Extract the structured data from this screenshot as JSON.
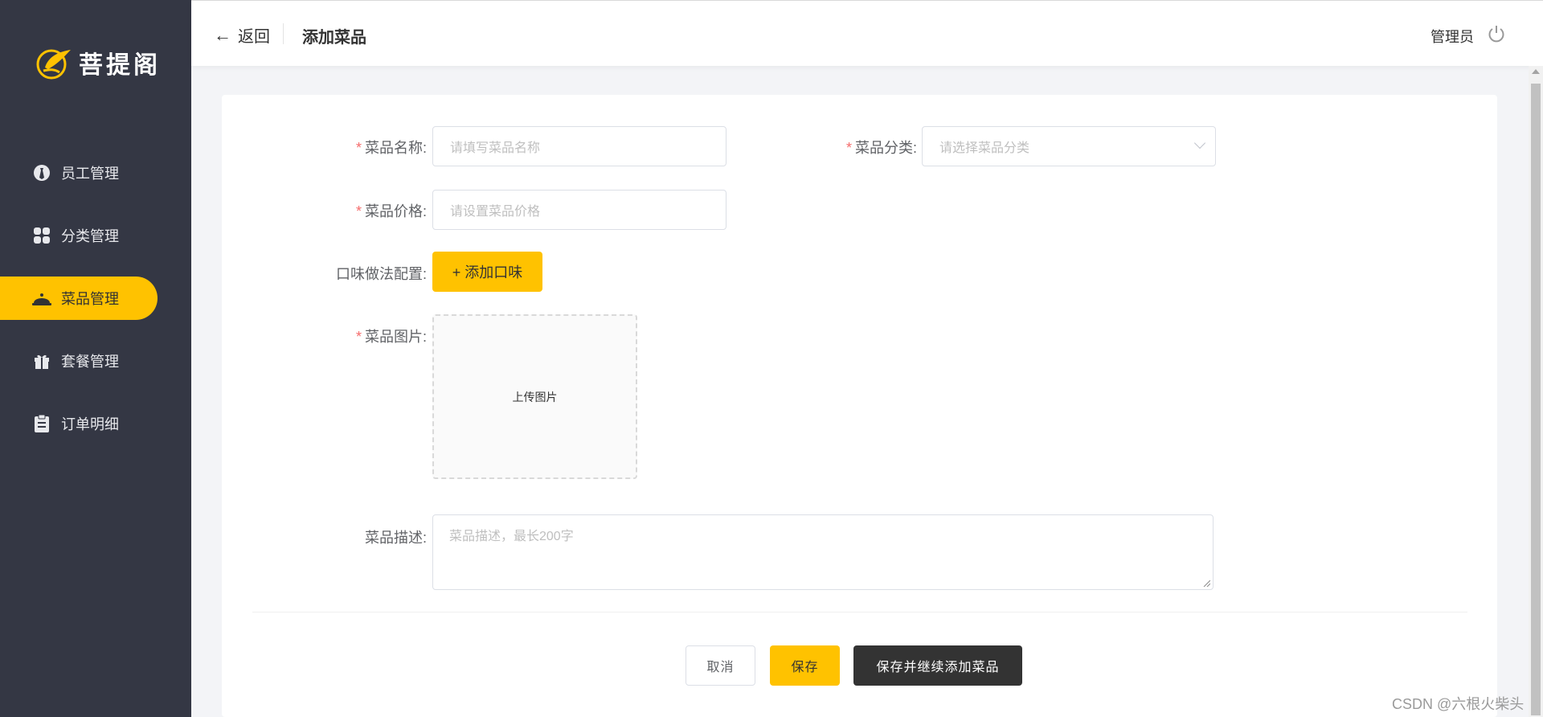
{
  "app": {
    "logo_text": "菩提阁"
  },
  "sidebar": {
    "items": [
      {
        "label": "员工管理",
        "icon": "employee-icon",
        "active": false
      },
      {
        "label": "分类管理",
        "icon": "category-icon",
        "active": false
      },
      {
        "label": "菜品管理",
        "icon": "dish-icon",
        "active": true
      },
      {
        "label": "套餐管理",
        "icon": "gift-icon",
        "active": false
      },
      {
        "label": "订单明细",
        "icon": "clipboard-icon",
        "active": false
      }
    ]
  },
  "header": {
    "back_label": "返回",
    "title": "添加菜品",
    "user": "管理员",
    "power_icon": "power-icon"
  },
  "form": {
    "dish_name": {
      "label": "菜品名称:",
      "placeholder": "请填写菜品名称",
      "required": true
    },
    "dish_category": {
      "label": "菜品分类:",
      "placeholder": "请选择菜品分类",
      "required": true
    },
    "dish_price": {
      "label": "菜品价格:",
      "placeholder": "请设置菜品价格",
      "required": true
    },
    "flavor": {
      "label": "口味做法配置:",
      "button": "+ 添加口味"
    },
    "dish_image": {
      "label": "菜品图片:",
      "upload_text": "上传图片",
      "required": true
    },
    "description": {
      "label": "菜品描述:",
      "placeholder": "菜品描述，最长200字"
    },
    "required_mark": "*"
  },
  "actions": {
    "cancel": "取消",
    "save": "保存",
    "save_continue": "保存并继续添加菜品"
  },
  "watermark": "CSDN @六根火柴头",
  "colors": {
    "sidebar_bg": "#343744",
    "accent": "#ffc200",
    "dark_button": "#333333",
    "required": "#f56c6c"
  }
}
